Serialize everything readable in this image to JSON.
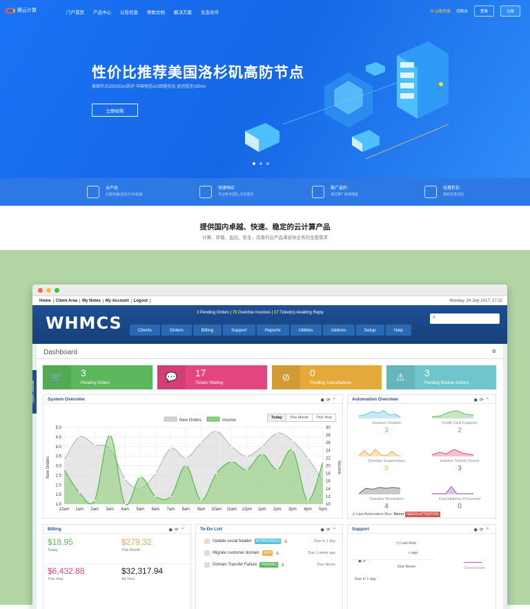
{
  "topnav": {
    "logo_text": "腾云计算",
    "items": [
      "门户首页",
      "产品中心",
      "公告信息",
      "帮助文档",
      "解决方案",
      "生态合作"
    ],
    "right": {
      "promo": "云服务器",
      "console": "控制台",
      "login": "登录",
      "register": "注册"
    }
  },
  "hero": {
    "title": "性价比推荐美国洛杉矶高防节点",
    "subtitle": "美国节点30GDDos防护  中国电信cn2回程优化  延迟低至150ms",
    "cta": "立即抢购"
  },
  "features": [
    {
      "title": "云产品",
      "sub": "云服务器/虚机/CDN加速"
    },
    {
      "title": "快速响应",
      "sub": "专业技术团队,无忧服务"
    },
    {
      "title": "推广返利",
      "sub": "通过推广获得佣金"
    },
    {
      "title": "优惠折扣",
      "sub": "最新优惠活动"
    }
  ],
  "band": {
    "title": "提供国内卓越、快速、稳定的云计算产品",
    "subtitle": "计算、存储、监控、安全，完善的云产品满足你业务的全面需求"
  },
  "window": {
    "menu": [
      "Home",
      "Client Area",
      "My Notes",
      "My Account",
      "Logout"
    ],
    "date": "Monday, 24 July 2017, 17:22",
    "brand": "WHMCS",
    "alerts": {
      "pending_orders": "3",
      "pending_orders_label": " Pending Orders | ",
      "overdue": "73",
      "overdue_label": " Overdue Invoices | ",
      "tickets": "17",
      "tickets_label": " Ticket(s) Awaiting Reply"
    },
    "tabs": [
      "Clients",
      "Orders",
      "Billing",
      "Support",
      "Reports",
      "Utilities",
      "Addons",
      "Setup",
      "Help"
    ],
    "sidebar_tab": "Open Sidebar"
  },
  "dashboard": {
    "title": "Dashboard",
    "stats": [
      {
        "value": "3",
        "label": "Pending Orders",
        "color": "#5cb85c",
        "icon": "cart-icon",
        "glyph": "🛒"
      },
      {
        "value": "17",
        "label": "Tickets Waiting",
        "color": "#e2457f",
        "icon": "chat-icon",
        "glyph": "💬"
      },
      {
        "value": "0",
        "label": "Pending Cancellations",
        "color": "#e5a93a",
        "icon": "ban-icon",
        "glyph": "⊘"
      },
      {
        "value": "3",
        "label": "Pending Module Actions",
        "color": "#6fc5cc",
        "icon": "warning-icon",
        "glyph": "⚠"
      }
    ],
    "system_overview": {
      "title": "System Overview",
      "ranges": [
        "Today",
        "This Month",
        "This Year"
      ],
      "selected_range": "Today"
    },
    "automation": {
      "title": "Automation Overview",
      "items": [
        {
          "label": "Invoices Created",
          "value": "3",
          "color": "#5bc0de"
        },
        {
          "label": "Credit Card Captures",
          "value": "2",
          "color": "#5cb85c"
        },
        {
          "label": "Overdue Suspensions",
          "value": "0",
          "color": "#f0ad4e"
        },
        {
          "label": "Inactive Tickets Closed",
          "value": "3",
          "color": "#e2457f"
        },
        {
          "label": "Overdue Reminders",
          "value": "4",
          "color": "#666666"
        },
        {
          "label": "Cancellations Processed",
          "value": "0",
          "color": "#9b59b6"
        }
      ],
      "last_run_label": "Last Automation Run: ",
      "last_run_value": "Never",
      "attention": "NEEDS ATTENTION"
    },
    "billing": {
      "title": "Billing",
      "cells": [
        {
          "value": "$18.95",
          "label": "Today",
          "color": "#5cb85c"
        },
        {
          "value": "$279.32",
          "label": "This Month",
          "color": "#e5a93a"
        },
        {
          "value": "$6,432.88",
          "label": "This Year",
          "color": "#e2457f"
        },
        {
          "value": "$32,317.94",
          "label": "All Time",
          "color": "#222222"
        }
      ]
    },
    "todo": {
      "title": "To-Do List",
      "items": [
        {
          "text": "Update social header",
          "badge": "IN PROGRESS",
          "badge_color": "#5bc0de",
          "due": "Due in 1 day"
        },
        {
          "text": "Migrate customer domain",
          "badge": "NEW",
          "badge_color": "#f0ad4e",
          "due": "Due 1 week ago"
        },
        {
          "text": "Domain Transfer Failure",
          "badge": "PENDING",
          "badge_color": "#5cb85c",
          "due": "Due Never"
        }
      ]
    },
    "support": {
      "title": "Support",
      "fragments": {
        "last_auto": "Last Auto",
        "s_ago": "s ago",
        "due_never": "Due Never",
        "due_1day": "Due in 1 day",
        "cancessed": "Canccessed"
      }
    }
  },
  "chart_data": {
    "type": "area",
    "title": "",
    "legend": [
      "New Orders",
      "Income"
    ],
    "legend_position": "top-center",
    "categories": [
      "12am",
      "1am",
      "2am",
      "3am",
      "4am",
      "5am",
      "6am",
      "7am",
      "8am",
      "9am",
      "10am",
      "11am",
      "12pm",
      "1pm",
      "2pm",
      "3pm",
      "4pm",
      "5pm"
    ],
    "ylabel": "New Orders",
    "y2label": "Income",
    "ylim": [
      1.0,
      5.0
    ],
    "y2lim": [
      10,
      30
    ],
    "yticks": [
      "5.0",
      "4.5",
      "4.0",
      "3.5",
      "3.0",
      "2.5",
      "2.0",
      "1.5",
      "1.0"
    ],
    "y2ticks": [
      "30",
      "28",
      "26",
      "24",
      "22",
      "20",
      "18",
      "16",
      "14",
      "12",
      "10"
    ],
    "series": [
      {
        "name": "New Orders",
        "axis": "left",
        "color": "#d4d4d4",
        "values": [
          3.3,
          4.5,
          4.1,
          3.9,
          2.3,
          1.8,
          2.6,
          3.9,
          3.4,
          4.2,
          4.8,
          4.0,
          3.5,
          4.0,
          4.7,
          4.3,
          3.4,
          2.2
        ]
      },
      {
        "name": "Income",
        "axis": "right",
        "color": "#8fd17c",
        "values": [
          19,
          13,
          11,
          28,
          10,
          17,
          12,
          12,
          20,
          11,
          18,
          21,
          19,
          23,
          19,
          24,
          11,
          21
        ]
      }
    ]
  }
}
